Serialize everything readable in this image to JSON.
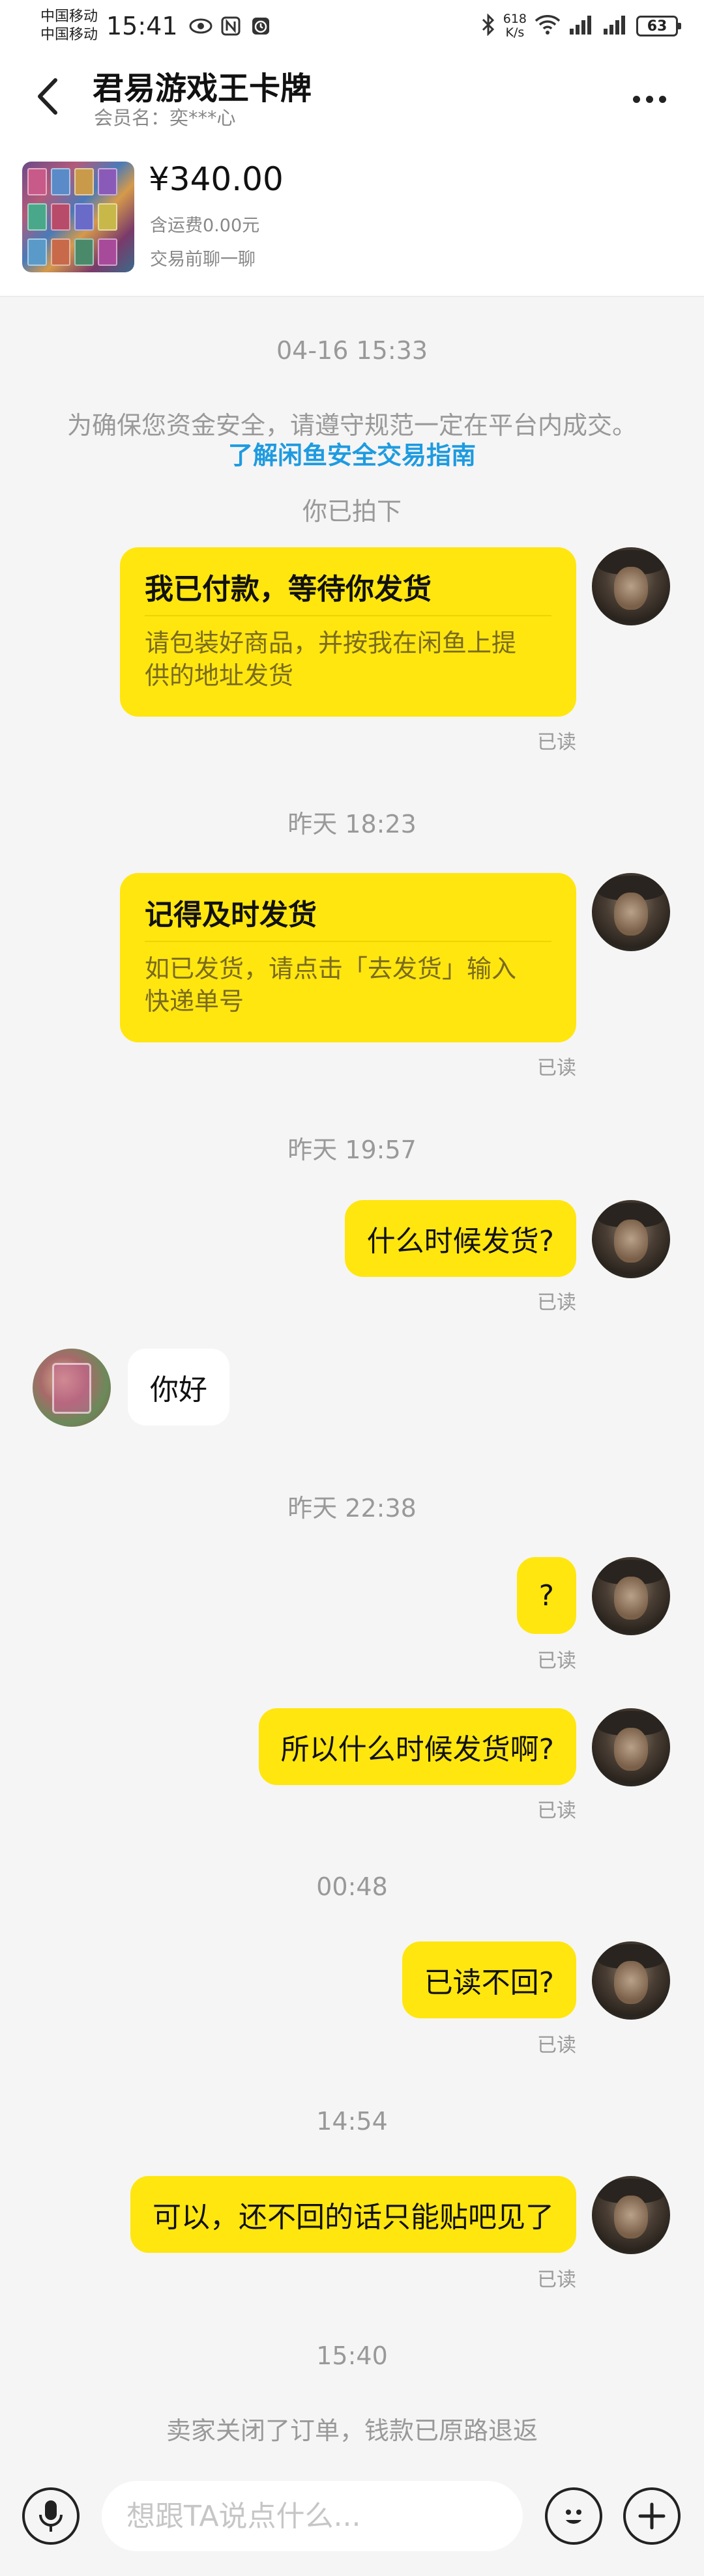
{
  "status_bar": {
    "carrier_1": "中国移动",
    "carrier_2": "中国移动",
    "time": "15:41",
    "net_speed_value": "618",
    "net_speed_unit": "K/s",
    "battery": "63"
  },
  "header": {
    "shop_name": "君易游戏王卡牌",
    "member_label": "会员名：奕***心"
  },
  "product": {
    "price": "¥340.00",
    "shipping": "含运费0.00元",
    "chat_hint": "交易前聊一聊"
  },
  "chat": {
    "ts_1": "04-16 15:33",
    "safety_notice": "为确保您资金安全，请遵守规范一定在平台内成交。",
    "safety_link": "了解闲鱼安全交易指南",
    "you_ordered": "你已拍下",
    "card_1": {
      "title": "我已付款，等待你发货",
      "body_1": "请包装好商品，并按我在闲鱼上提",
      "body_2": "供的地址发货"
    },
    "read_label": "已读",
    "ts_2": "昨天 18:23",
    "card_2": {
      "title": "记得及时发货",
      "body_1": "如已发货，请点击「去发货」输入",
      "body_2": "快递单号"
    },
    "ts_3": "昨天 19:57",
    "msg_1": "什么时候发货?",
    "msg_other": "你好",
    "ts_4": "昨天 22:38",
    "msg_2": "?",
    "msg_3": "所以什么时候发货啊?",
    "ts_5": "00:48",
    "msg_4": "已读不回?",
    "ts_6": "14:54",
    "msg_5": "可以，还不回的话只能贴吧见了",
    "ts_7": "15:40",
    "closed_notice": "卖家关闭了订单，钱款已原路退返"
  },
  "input": {
    "placeholder": "想跟TA说点什么..."
  },
  "colors": {
    "bubble": "#ffe60f",
    "link": "#1e9be0",
    "muted": "#999999"
  }
}
